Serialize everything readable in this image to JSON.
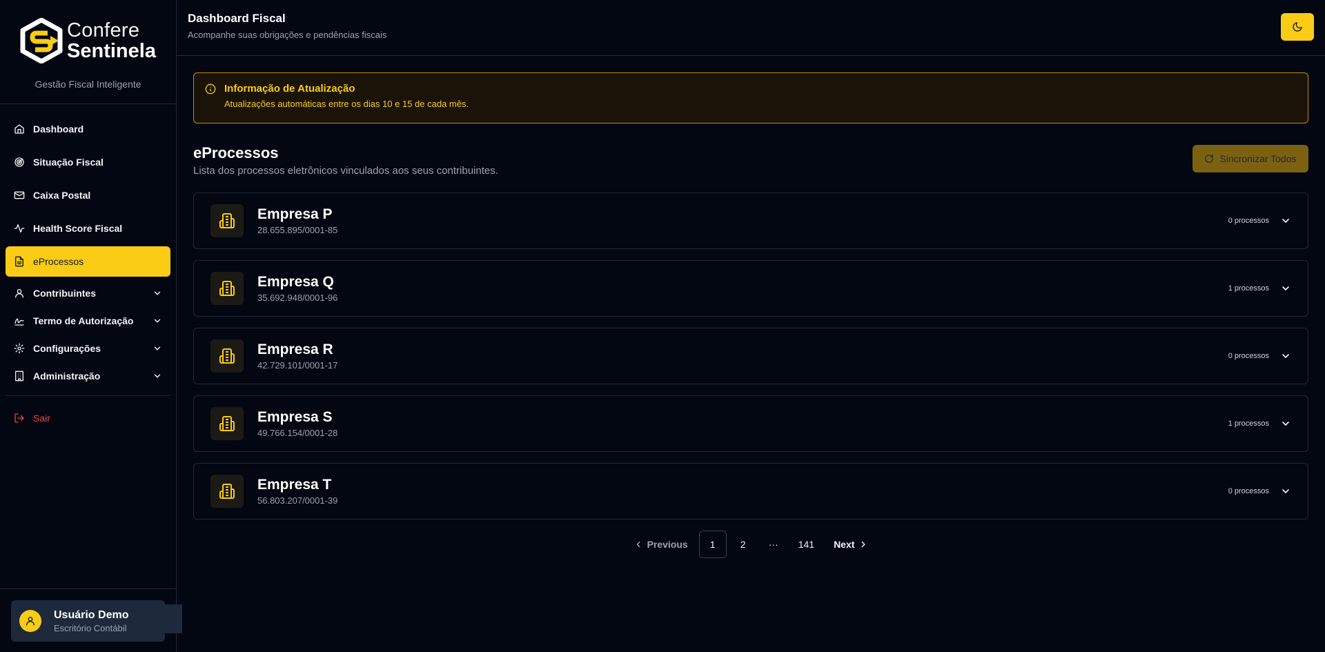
{
  "brand": {
    "word1": "Confere",
    "word2": "Sentinela",
    "tagline": "Gestão Fiscal Inteligente",
    "accent": "#facc15"
  },
  "sidebar": {
    "items": [
      {
        "label": "Dashboard",
        "icon": "home-icon"
      },
      {
        "label": "Situação Fiscal",
        "icon": "radar-icon"
      },
      {
        "label": "Caixa Postal",
        "icon": "mail-icon"
      },
      {
        "label": "Health Score Fiscal",
        "icon": "activity-icon"
      },
      {
        "label": "eProcessos",
        "icon": "file-text-icon",
        "active": true
      },
      {
        "label": "Contribuintes",
        "icon": "user-icon"
      },
      {
        "label": "Termo de Autorização",
        "icon": "signature-icon"
      },
      {
        "label": "Configurações",
        "icon": "gear-icon"
      },
      {
        "label": "Administração",
        "icon": "building-icon"
      }
    ],
    "logout": "Sair"
  },
  "user": {
    "name": "Usuário Demo",
    "role": "Escritório Contábil"
  },
  "header": {
    "title": "Dashboard Fiscal",
    "subtitle": "Acompanhe suas obrigações e pendências fiscais"
  },
  "alert": {
    "title": "Informação de Atualização",
    "text": "Atualizações automáticas entre os dias 10 e 15 de cada mês."
  },
  "section": {
    "title": "eProcessos",
    "subtitle": "Lista dos processos eletrônicos vinculados aos seus contribuintes.",
    "sync_label": "Sincronizar Todos"
  },
  "companies": [
    {
      "name": "Empresa P",
      "cnpj": "28.655.895/0001-85",
      "count": "0 processos"
    },
    {
      "name": "Empresa Q",
      "cnpj": "35.692.948/0001-96",
      "count": "1 processos"
    },
    {
      "name": "Empresa R",
      "cnpj": "42.729.101/0001-17",
      "count": "0 processos"
    },
    {
      "name": "Empresa S",
      "cnpj": "49.766.154/0001-28",
      "count": "1 processos"
    },
    {
      "name": "Empresa T",
      "cnpj": "56.803.207/0001-39",
      "count": "0 processos"
    }
  ],
  "pagination": {
    "previous": "Previous",
    "pages": [
      "1",
      "2"
    ],
    "ellipsis": "···",
    "last": "141",
    "next": "Next",
    "current": "1"
  }
}
